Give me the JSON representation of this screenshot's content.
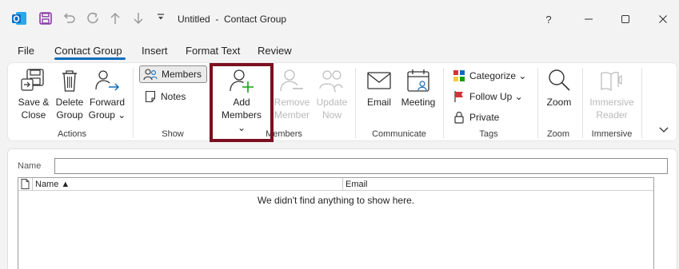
{
  "window": {
    "title": "Untitled  -  Contact Group",
    "help": "?",
    "controls": [
      "minimize",
      "maximize",
      "close"
    ]
  },
  "quick_access": {
    "icons": [
      "outlook-icon",
      "save-icon",
      "undo-icon",
      "redo-icon",
      "up-icon",
      "down-icon",
      "customize-icon"
    ]
  },
  "menu": {
    "tabs": [
      "File",
      "Contact Group",
      "Insert",
      "Format Text",
      "Review"
    ],
    "active": "Contact Group"
  },
  "ribbon": {
    "actions": {
      "label": "Actions",
      "save_close": [
        "Save &",
        "Close"
      ],
      "delete_group": [
        "Delete",
        "Group"
      ],
      "forward_group": [
        "Forward",
        "Group ⌄"
      ]
    },
    "show": {
      "label": "Show",
      "members": "Members",
      "notes": "Notes"
    },
    "members": {
      "label": "Members",
      "add_members": [
        "Add",
        "Members ⌄"
      ],
      "remove_member": [
        "Remove",
        "Member"
      ],
      "update_now": [
        "Update",
        "Now"
      ]
    },
    "communicate": {
      "label": "Communicate",
      "email": "Email",
      "meeting": "Meeting"
    },
    "tags": {
      "label": "Tags",
      "categorize": "Categorize ⌄",
      "follow_up": "Follow Up ⌄",
      "private": "Private"
    },
    "zoom": {
      "label": "Zoom",
      "zoom": "Zoom"
    },
    "immersive": {
      "label": "Immersive",
      "reader": [
        "Immersive",
        "Reader"
      ]
    }
  },
  "form": {
    "name_label": "Name",
    "name_value": ""
  },
  "grid": {
    "columns": [
      "Name ▲",
      "Email"
    ],
    "empty_message": "We didn't find anything to show here."
  },
  "colors": {
    "accent": "#0f6cbd",
    "highlight": "#7a1020",
    "outlook_blue": "#0f6cbd",
    "save_purple": "#8a3ba8"
  }
}
